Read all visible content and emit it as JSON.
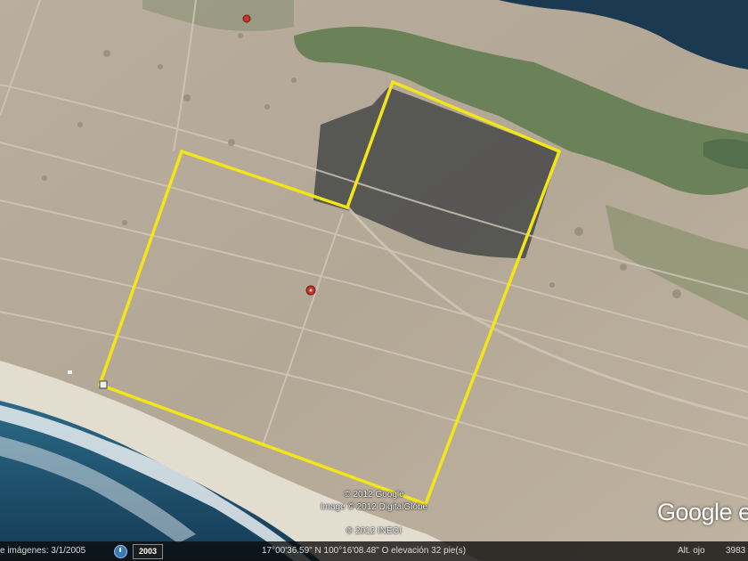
{
  "map": {
    "type": "satellite",
    "parcel_outline_color": "#f2e619",
    "marker_color": "#c0392b",
    "ocean_color": "#1f4d6b",
    "lagoon_color": "#1a3a52"
  },
  "attribution": {
    "line1": "© 2012 Google",
    "line2": "Image © 2012 DigitalGlobe",
    "line3": "© 2012 INEGI"
  },
  "logo": "Google e",
  "statusbar": {
    "imagery_date": "e imágenes: 3/1/2005",
    "year_button": "2003",
    "coordinates": "17°00'36.59\" N 100°16'08.48\" O elevación   32 pie(s)",
    "eye_alt_label": "Alt. ojo",
    "eye_alt_value": "3983"
  }
}
